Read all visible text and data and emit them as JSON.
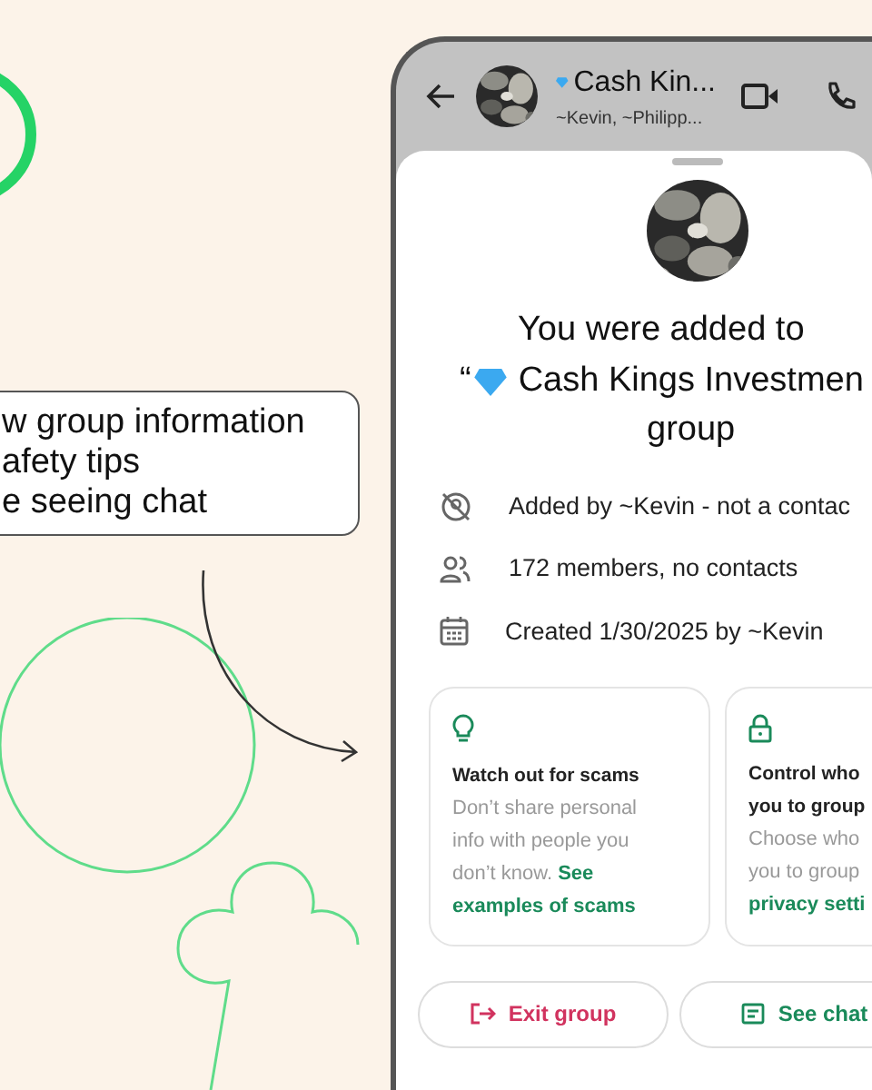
{
  "callout": {
    "lines": [
      "w group information",
      "afety tips",
      "e seeing chat"
    ]
  },
  "header": {
    "title": "Cash Kin...",
    "subtitle": "~Kevin, ~Philipp..."
  },
  "sheet": {
    "headline_1": "You were added to",
    "quote": "“",
    "group_name": "Cash Kings Investmen",
    "headline_3": "group",
    "info": [
      {
        "kind": "not-contact",
        "text": "Added by ~Kevin - not a contac"
      },
      {
        "kind": "members",
        "text": "172 members, no contacts"
      },
      {
        "kind": "calendar",
        "text": "Created 1/30/2025 by ~Kevin"
      }
    ],
    "cards": [
      {
        "kind": "bulb",
        "title_lines": [
          "Watch out for scams"
        ],
        "body_lines": [
          "Don’t share personal",
          "info with people you",
          "don’t know."
        ],
        "link_lines": [
          "See",
          "examples of scams"
        ]
      },
      {
        "kind": "lock",
        "title_lines": [
          "Control who",
          "you to group"
        ],
        "body_lines": [
          "Choose who",
          "you to group"
        ],
        "link_lines": [
          "privacy setti"
        ]
      }
    ],
    "buttons": [
      {
        "kind": "exit",
        "label": "Exit group"
      },
      {
        "kind": "chat",
        "label": "See chat"
      }
    ]
  }
}
